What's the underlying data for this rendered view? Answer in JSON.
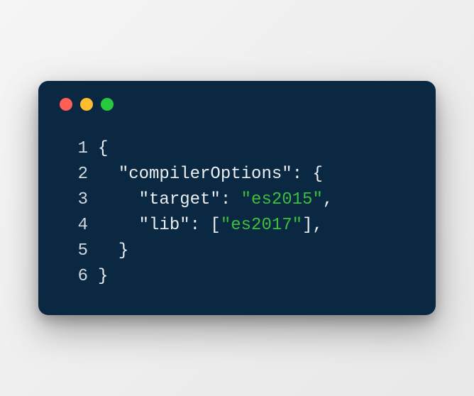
{
  "window": {
    "controls": {
      "close": "close",
      "minimize": "minimize",
      "zoom": "zoom"
    }
  },
  "code": {
    "lines": [
      {
        "num": "1",
        "indent": "",
        "tokens": [
          {
            "t": "punct",
            "v": "{"
          }
        ]
      },
      {
        "num": "2",
        "indent": "  ",
        "tokens": [
          {
            "t": "key",
            "v": "\"compilerOptions\""
          },
          {
            "t": "punct",
            "v": ": {"
          }
        ]
      },
      {
        "num": "3",
        "indent": "    ",
        "tokens": [
          {
            "t": "key",
            "v": "\"target\""
          },
          {
            "t": "punct",
            "v": ": "
          },
          {
            "t": "string",
            "v": "\"es2015\""
          },
          {
            "t": "punct",
            "v": ","
          }
        ]
      },
      {
        "num": "4",
        "indent": "    ",
        "tokens": [
          {
            "t": "key",
            "v": "\"lib\""
          },
          {
            "t": "punct",
            "v": ": ["
          },
          {
            "t": "string",
            "v": "\"es2017\""
          },
          {
            "t": "punct",
            "v": "],"
          }
        ]
      },
      {
        "num": "5",
        "indent": "  ",
        "tokens": [
          {
            "t": "punct",
            "v": "}"
          }
        ]
      },
      {
        "num": "6",
        "indent": "",
        "tokens": [
          {
            "t": "punct",
            "v": "}"
          }
        ]
      }
    ]
  }
}
